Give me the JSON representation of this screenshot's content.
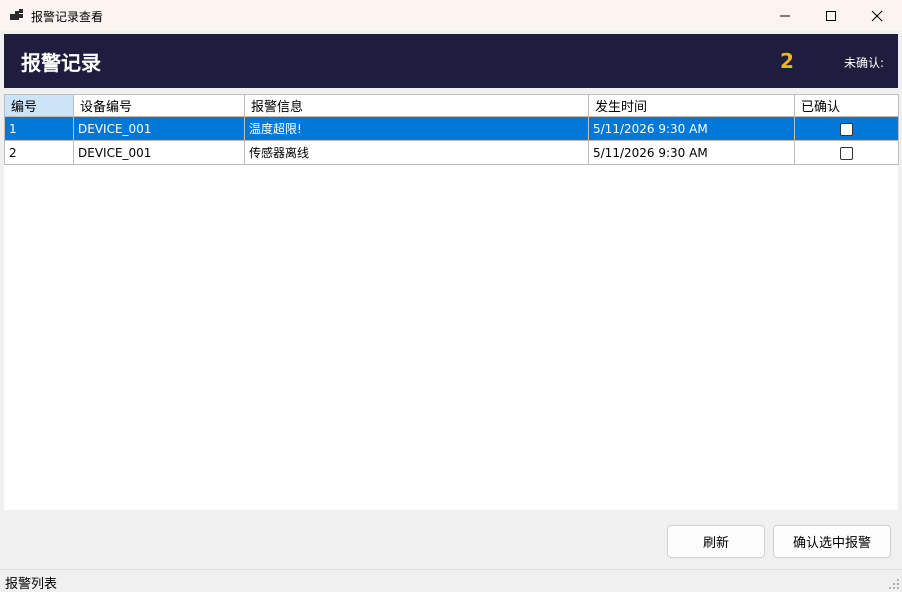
{
  "window": {
    "title": "报警记录查看",
    "app_icon": "app-grid-icon",
    "controls": [
      "minimize-icon",
      "maximize-icon",
      "close-icon"
    ]
  },
  "header": {
    "title": "报警记录",
    "count": "2",
    "unconfirmed_label": "未确认:",
    "background_color": "#1f1d3d",
    "count_color": "#f0b51c"
  },
  "grid": {
    "columns": [
      "编号",
      "设备编号",
      "报警信息",
      "发生时间",
      "已确认"
    ],
    "rows": [
      {
        "id": "1",
        "device": "DEVICE_001",
        "message": "温度超限!",
        "time": "5/11/2026 9:30 AM",
        "confirmed": false,
        "selected": true
      },
      {
        "id": "2",
        "device": "DEVICE_001",
        "message": "传感器离线",
        "time": "5/11/2026 9:30 AM",
        "confirmed": false,
        "selected": false
      }
    ],
    "selection_color": "#0078d7"
  },
  "buttons": {
    "refresh": "刷新",
    "confirm": "确认选中报警"
  },
  "status": {
    "text": "报警列表"
  }
}
